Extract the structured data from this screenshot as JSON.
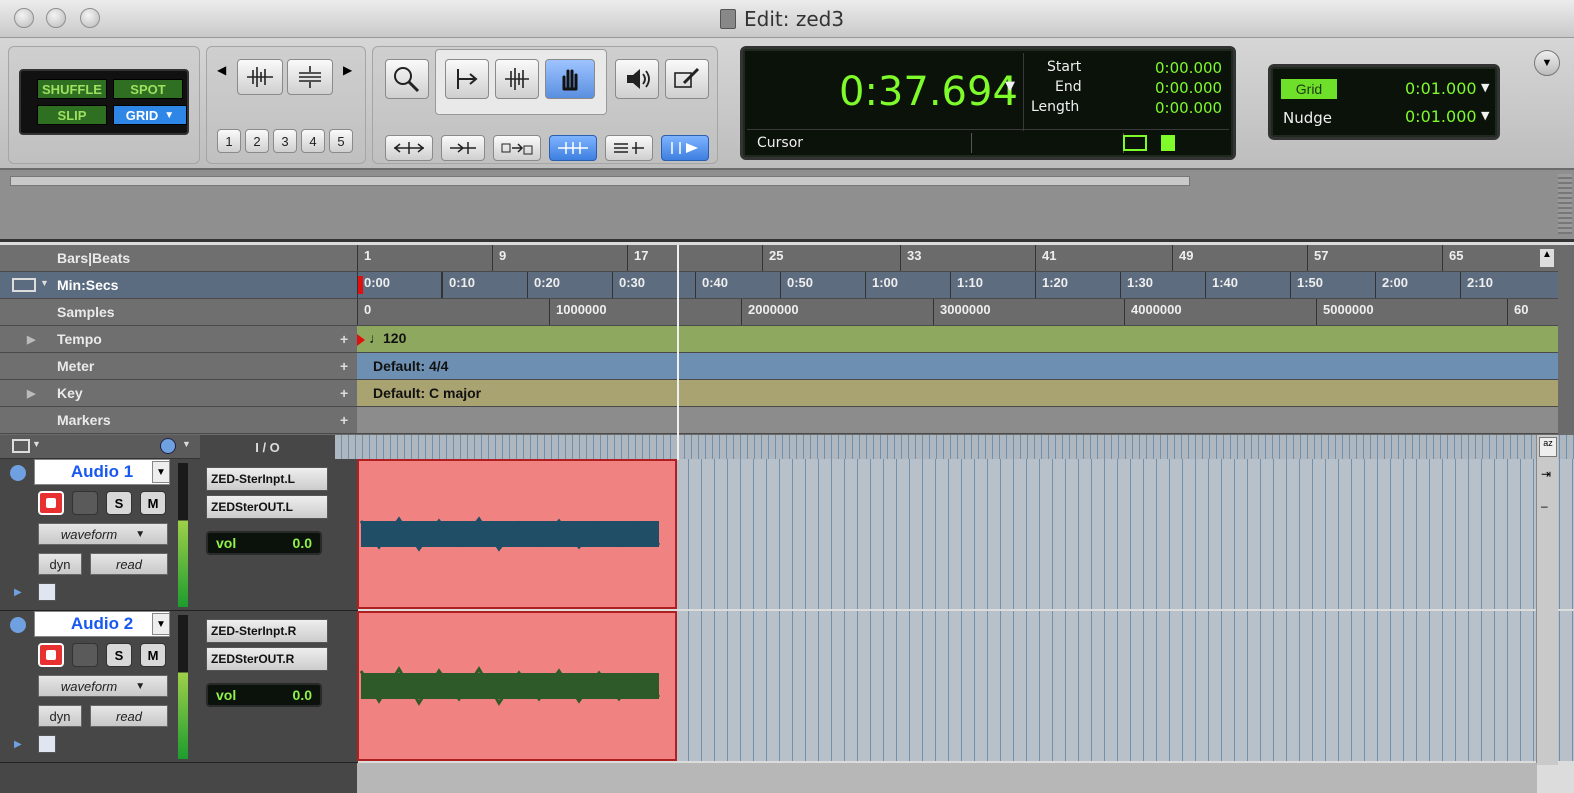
{
  "window": {
    "title": "Edit: zed3"
  },
  "edit_modes": {
    "shuffle": "SHUFFLE",
    "spot": "SPOT",
    "slip": "SLIP",
    "grid": "GRID"
  },
  "zoom_presets": [
    "1",
    "2",
    "3",
    "4",
    "5"
  ],
  "counter": {
    "main": "0:37.694",
    "start_label": "Start",
    "start_value": "0:00.000",
    "end_label": "End",
    "end_value": "0:00.000",
    "length_label": "Length",
    "length_value": "0:00.000",
    "cursor_label": "Cursor"
  },
  "grid_nudge": {
    "grid_label": "Grid",
    "grid_value": "0:01.000",
    "nudge_label": "Nudge",
    "nudge_value": "0:01.000"
  },
  "rulers": {
    "bars_beats_label": "Bars|Beats",
    "bars_ticks": [
      "1",
      "9",
      "17",
      "25",
      "33",
      "41",
      "49",
      "57",
      "65"
    ],
    "minsecs_label": "Min:Secs",
    "minsecs_ticks": [
      "0:00",
      "0:10",
      "0:20",
      "0:30",
      "0:40",
      "0:50",
      "1:00",
      "1:10",
      "1:20",
      "1:30",
      "1:40",
      "1:50",
      "2:00",
      "2:10"
    ],
    "samples_label": "Samples",
    "samples_ticks": [
      "0",
      "1000000",
      "2000000",
      "3000000",
      "4000000",
      "5000000",
      "60"
    ],
    "tempo_label": "Tempo",
    "tempo_value": "120",
    "meter_label": "Meter",
    "meter_value": "Default: 4/4",
    "key_label": "Key",
    "key_value": "Default: C major",
    "markers_label": "Markers"
  },
  "io_header": "I / O",
  "tracks": [
    {
      "name": "Audio 1",
      "view": "waveform",
      "dyn": "dyn",
      "auto": "read",
      "input": "ZED-SterInpt.L",
      "output": "ZEDSterOUT.L",
      "vol_label": "vol",
      "vol_value": "0.0",
      "solo": "S",
      "mute": "M"
    },
    {
      "name": "Audio 2",
      "view": "waveform",
      "dyn": "dyn",
      "auto": "read",
      "input": "ZED-SterInpt.R",
      "output": "ZEDSterOUT.R",
      "vol_label": "vol",
      "vol_value": "0.0",
      "solo": "S",
      "mute": "M"
    }
  ],
  "colors": {
    "clip": "#f18282",
    "waveform1": "#1f4e66",
    "waveform2": "#2d5a28",
    "lcd_green": "#7ffa2a",
    "tempo_lane": "#8fa860",
    "meter_lane": "#6d8fb1",
    "key_lane": "#a9a271"
  }
}
